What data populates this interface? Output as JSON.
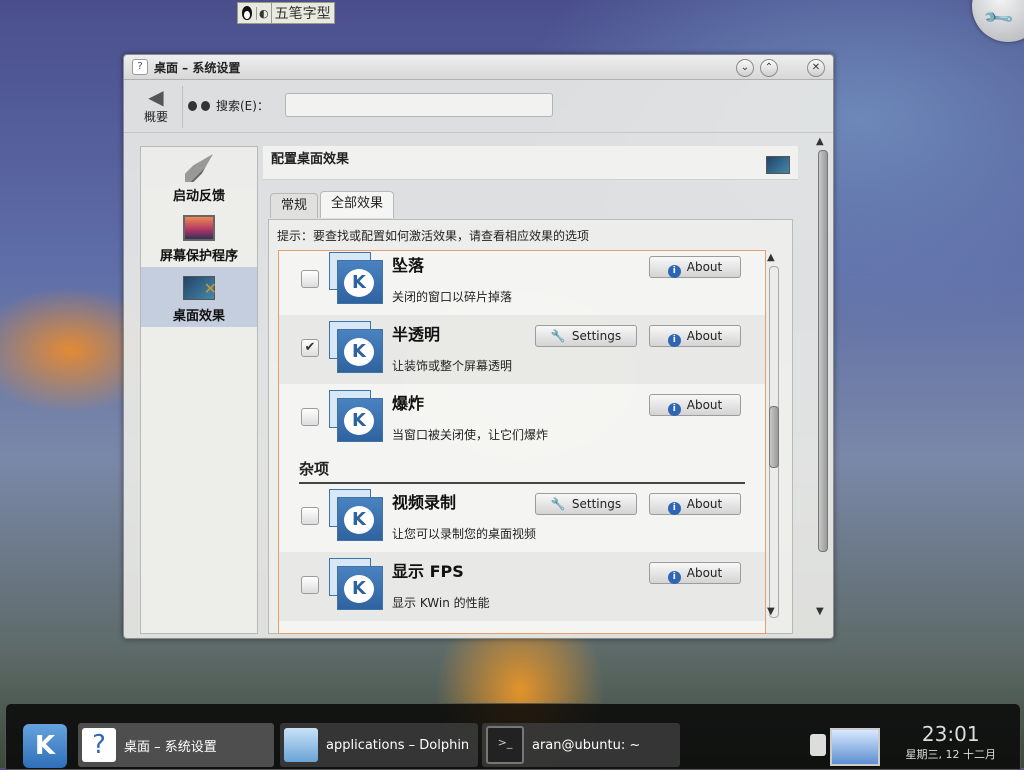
{
  "ime": {
    "name": "五笔字型"
  },
  "window": {
    "title": "桌面 – 系统设置",
    "toolbar": {
      "back_label": "概要",
      "search_label": "搜索(E)：",
      "search_value": ""
    },
    "sidebar": {
      "items": [
        {
          "label": "启动反馈",
          "icon": "rocket-icon",
          "selected": false
        },
        {
          "label": "屏幕保护程序",
          "icon": "screensaver-icon",
          "selected": false
        },
        {
          "label": "桌面效果",
          "icon": "desktop-effects-icon",
          "selected": true
        }
      ]
    },
    "content": {
      "header": "配置桌面效果",
      "tabs": [
        {
          "label": "常规",
          "active": false
        },
        {
          "label": "全部效果",
          "active": true
        }
      ],
      "hint": "提示：要查找或配置如何激活效果，请查看相应效果的选项",
      "section_label": "杂项",
      "effects": [
        {
          "name": "坠落",
          "desc": "关闭的窗口以碎片掉落",
          "checked": false,
          "settings": false
        },
        {
          "name": "半透明",
          "desc": "让装饰或整个屏幕透明",
          "checked": true,
          "settings": true
        },
        {
          "name": "爆炸",
          "desc": "当窗口被关闭使，让它们爆炸",
          "checked": false,
          "settings": false
        },
        {
          "name": "视频录制",
          "desc": "让您可以录制您的桌面视频",
          "checked": false,
          "settings": true
        },
        {
          "name": "显示 FPS",
          "desc": "显示 KWin 的性能",
          "checked": false,
          "settings": false
        }
      ],
      "settings_label": "Settings",
      "about_label": "About"
    }
  },
  "taskbar": {
    "tasks": [
      {
        "label": "桌面 – 系统设置",
        "active": true
      },
      {
        "label": "applications – Dolphin",
        "active": false
      },
      {
        "label": "aran@ubuntu: ~",
        "active": false
      }
    ],
    "clock": {
      "time": "23:01",
      "date": "星期三, 12 十二月"
    }
  }
}
